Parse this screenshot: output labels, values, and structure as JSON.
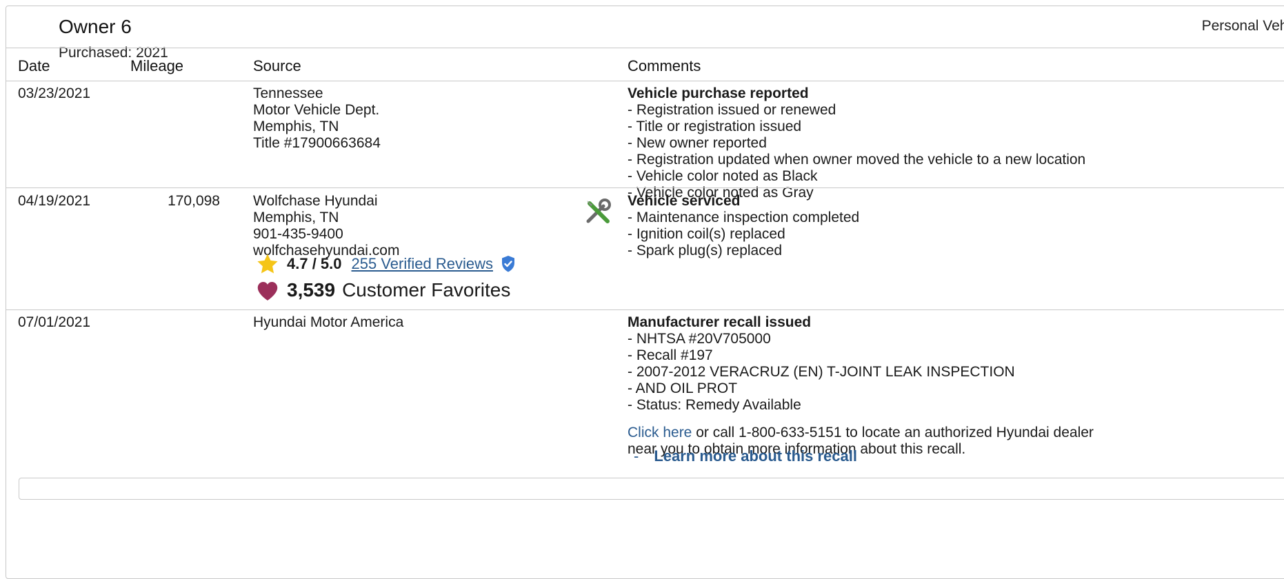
{
  "owner": {
    "title": "Owner 6",
    "purchased": "Purchased: 2021",
    "vehicle_type": "Personal Vehicle"
  },
  "table": {
    "headers": [
      "Date",
      "Mileage",
      "Source",
      "Comments"
    ],
    "rows": [
      {
        "date": "03/23/2021",
        "mileage": "",
        "source": [
          "Tennessee",
          "Motor Vehicle Dept.",
          "Memphis, TN",
          "Title #17900663684"
        ],
        "comment_title": "Vehicle purchase reported",
        "comments": [
          "- Registration issued or renewed",
          "- Title or registration issued",
          "- New owner reported",
          "- Registration updated when owner moved the vehicle to a new location",
          "- Vehicle color noted as Black",
          "- Vehicle color noted as Gray"
        ]
      },
      {
        "date": "04/19/2021",
        "mileage": "170,098",
        "source": [
          "Wolfchase Hyundai",
          "Memphis, TN",
          "901-435-9400",
          "wolfchasehyundai.com"
        ],
        "rating": {
          "score": "4.7 / 5.0",
          "reviews_link": "255 Verified Reviews"
        },
        "favorites": {
          "count": "3,539",
          "label": "Customer Favorites"
        },
        "icon": "service-tools-icon",
        "comment_title": "Vehicle serviced",
        "comments": [
          "- Maintenance inspection completed",
          "- Ignition coil(s) replaced",
          "- Spark plug(s) replaced"
        ]
      },
      {
        "date": "07/01/2021",
        "mileage": "",
        "source": [
          "Hyundai Motor America"
        ],
        "comment_title": "Manufacturer recall issued",
        "comments": [
          "- NHTSA #20V705000",
          "- Recall #197",
          "- 2007-2012 VERACRUZ (EN) T-JOINT LEAK INSPECTION",
          "- AND OIL PROT",
          "- Status: Remedy Available"
        ],
        "recall_note": {
          "link": "Click here",
          "text_1": " or call 1-800-633-5151 to locate an authorized Hyundai dealer",
          "text_2": "near you to obtain more information about this recall."
        },
        "learn_more_dash": "-",
        "learn_more": "Learn more about this recall"
      }
    ]
  },
  "colors": {
    "link": "#2a5b8f",
    "star": "#f5c518",
    "heart": "#9b2f5a",
    "verified_badge": "#3a7bd5",
    "border": "#c8c8c8"
  }
}
